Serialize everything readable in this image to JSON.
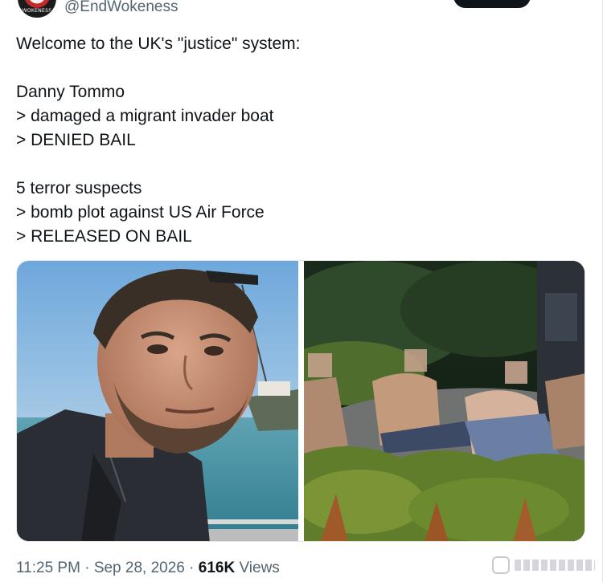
{
  "header": {
    "handle": "@EndWokeness",
    "avatar_text": "WOKENESS",
    "follow_button_label": ""
  },
  "tweet": {
    "lines": [
      "Welcome to the UK's \"justice\" system:",
      "",
      "Danny Tommo",
      "> damaged a migrant invader boat",
      "> DENIED BAIL",
      "",
      "5 terror suspects",
      "> bomb plot against US Air Force",
      "> RELEASED ON BAIL"
    ]
  },
  "media": {
    "left_photo": "man-on-boat-selfie",
    "right_photo": "group-arrest-night"
  },
  "meta": {
    "time": "11:25 PM",
    "separator": "·",
    "date": "Sep 28, 2026",
    "views_count": "616K",
    "views_label": "Views"
  },
  "colors": {
    "text": "#0f1419",
    "muted": "#536471",
    "button": "#0f1419"
  }
}
